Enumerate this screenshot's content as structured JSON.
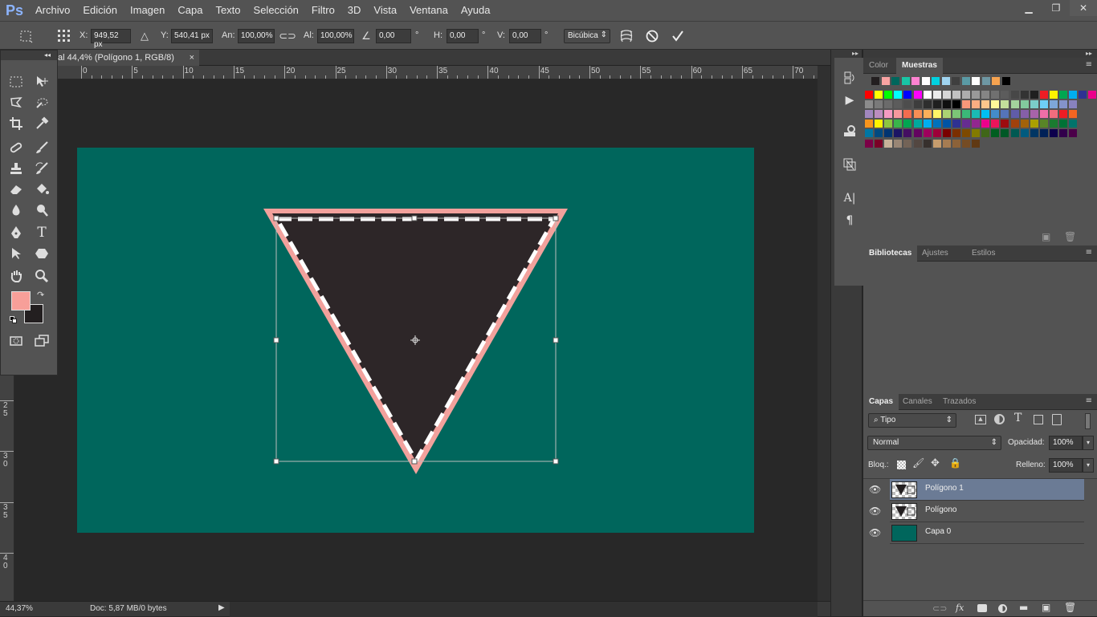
{
  "app": {
    "logo": "Ps"
  },
  "menu": [
    "Archivo",
    "Edición",
    "Imagen",
    "Capa",
    "Texto",
    "Selección",
    "Filtro",
    "3D",
    "Vista",
    "Ventana",
    "Ayuda"
  ],
  "window_controls": {
    "minimize": "▁",
    "restore": "❐",
    "close": "✕"
  },
  "options": {
    "x_label": "X:",
    "x_value": "949,52 px",
    "y_label": "Y:",
    "y_value": "540,41 px",
    "w_label": "An:",
    "w_value": "100,00%",
    "h_label": "Al:",
    "h_value": "100,00%",
    "angle_value": "0,00",
    "deg": "°",
    "hskew_label": "H:",
    "hskew_value": "0,00",
    "vskew_label": "V:",
    "vskew_value": "0,00",
    "interp": "Bicúbica"
  },
  "document_tab": {
    "title": "al 44,4% (Polígono 1, RGB/8)",
    "close": "×"
  },
  "ruler_h": [
    "0",
    "5",
    "10",
    "15",
    "20",
    "25",
    "30",
    "35",
    "40",
    "45",
    "50",
    "55",
    "60",
    "65",
    "70"
  ],
  "ruler_v": [
    "2\n5",
    "3\n0",
    "3\n5",
    "4\n0"
  ],
  "status": {
    "zoom": "44,37%",
    "doc": "Doc: 5,87 MB/0 bytes"
  },
  "colors": {
    "foreground": "#f79f99",
    "background": "#231f20",
    "canvas_bg": "#00665c",
    "shape_fill": "#2d2628",
    "stroke": "#f2a19c",
    "selected_layer": "#6b7b95"
  },
  "panels": {
    "color_tab": "Color",
    "swatches_tab": "Muestras",
    "libraries_tab": "Bibliotecas",
    "adjust_tab": "Ajustes",
    "styles_tab": "Estilos",
    "layers_tab": "Capas",
    "channels_tab": "Canales",
    "paths_tab": "Trazados"
  },
  "layers_panel": {
    "filter": "Tipo",
    "blend_mode": "Normal",
    "opacity_label": "Opacidad:",
    "opacity_value": "100%",
    "lock_label": "Bloq.:",
    "fill_label": "Relleno:",
    "fill_value": "100%",
    "layers": [
      {
        "name": "Polígono 1",
        "selected": true
      },
      {
        "name": "Polígono",
        "selected": false
      },
      {
        "name": "Capa 0",
        "selected": false
      }
    ]
  },
  "swatch_rows": [
    [
      "#231f20",
      "#f9a3a3",
      "#00665c",
      "#19c5a5",
      "#ff82d1",
      "#ffffff",
      "#00d1e0",
      "#9fd4f0",
      "#3f3f3f",
      "#5a9aa5",
      "#ffffff",
      "#6e97a3",
      "#f6a350",
      "#000000"
    ],
    [
      "#ff0000",
      "#ffff00",
      "#00ff00",
      "#00ffff",
      "#0000ff",
      "#ff00ff",
      "#ffffff",
      "#ebebeb",
      "#d6d6d6",
      "#c2c2c2",
      "#adadad",
      "#999999",
      "#858585",
      "#707070",
      "#5c5c5c",
      "#474747",
      "#333333",
      "#1f1f1f",
      "#ed1c24",
      "#fff200",
      "#00a651",
      "#00aeef",
      "#2e3192",
      "#ec008c"
    ],
    [
      "#8c8c8c",
      "#7a7a7a",
      "#6b6b6b",
      "#5c5c5c",
      "#4d4d4d",
      "#3d3d3d",
      "#2e2e2e",
      "#1f1f1f",
      "#0f0f0f",
      "#000000",
      "#f7977a",
      "#fbad82",
      "#fdc68c",
      "#fff799",
      "#c4df9b",
      "#a3d39c",
      "#82ca9d",
      "#7bcdc8",
      "#6ecff6",
      "#7ea7d8",
      "#8493ca",
      "#8882be"
    ],
    [
      "#a187be",
      "#bc8dbf",
      "#f49ac2",
      "#f6989d",
      "#f26c4f",
      "#f68e55",
      "#fbaf5a",
      "#fff467",
      "#acd372",
      "#7cc576",
      "#3bb878",
      "#1abbb4",
      "#00bff3",
      "#438ccb",
      "#5574b9",
      "#605ca9",
      "#855fa8",
      "#a763a9",
      "#ef6ea8",
      "#f16d7e",
      "#ed1c24",
      "#f26522"
    ],
    [
      "#f7941d",
      "#fff200",
      "#8dc63f",
      "#39b54a",
      "#00a651",
      "#00a99d",
      "#00aeef",
      "#0072bc",
      "#0054a5",
      "#2e3192",
      "#662d91",
      "#92278f",
      "#ec008c",
      "#ed145b",
      "#9e0b0f",
      "#a0410d",
      "#a36209",
      "#aba000",
      "#598527",
      "#1a7b30",
      "#007236",
      "#00746b"
    ],
    [
      "#0076a3",
      "#004a80",
      "#003471",
      "#1b1464",
      "#440e62",
      "#630460",
      "#9e005d",
      "#9e0039",
      "#790000",
      "#7b2e00",
      "#7d4900",
      "#827b00",
      "#406618",
      "#005e20",
      "#005826",
      "#005952",
      "#005b7f",
      "#003663",
      "#002157",
      "#0d004c",
      "#32004b",
      "#4b0049"
    ],
    [
      "#7b0046",
      "#7a0026",
      "#c7b299",
      "#998675",
      "#736357",
      "#534741",
      "#37302d",
      "#c69c6d",
      "#a67c52",
      "#8c6239",
      "#754c24",
      "#603913"
    ]
  ],
  "tools": [
    "marquee",
    "move",
    "lasso",
    "quick-select",
    "crop",
    "eyedropper",
    "healing",
    "brush",
    "stamp",
    "history-brush",
    "eraser",
    "paint-bucket",
    "blur",
    "dodge",
    "pen",
    "text",
    "path-select",
    "shape",
    "hand",
    "zoom"
  ]
}
